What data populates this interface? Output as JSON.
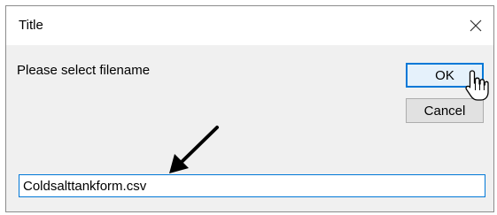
{
  "window": {
    "title": "Title",
    "close_icon": "close-icon"
  },
  "dialog": {
    "prompt": "Please select filename",
    "ok_label": "OK",
    "cancel_label": "Cancel",
    "filename_value": "Coldsalttankform.csv"
  },
  "overlay": {
    "cursor_icon": "hand-pointer-icon",
    "annotation_icon": "arrow-annotation-icon"
  },
  "colors": {
    "accent": "#0078d7",
    "window_bg": "#f0f0f0",
    "arrow": "#000000"
  }
}
